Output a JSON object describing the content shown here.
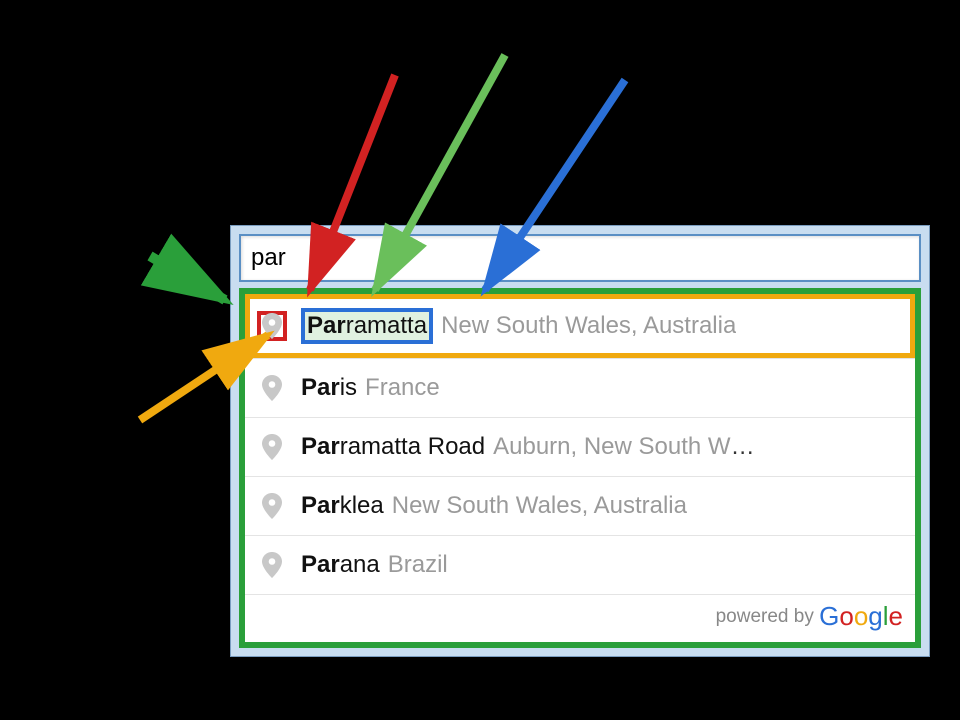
{
  "search": {
    "value": "par"
  },
  "suggestions": [
    {
      "matched": "Par",
      "rest": "ramatta",
      "secondary": "New South Wales, Australia",
      "highlighted": true
    },
    {
      "matched": "Par",
      "rest": "is",
      "secondary": "France",
      "highlighted": false
    },
    {
      "matched": "Par",
      "rest": "ramatta Road",
      "secondary": "Auburn, New South W",
      "truncated": true,
      "highlighted": false
    },
    {
      "matched": "Par",
      "rest": "klea",
      "secondary": "New South Wales, Australia",
      "highlighted": false
    },
    {
      "matched": "Par",
      "rest": "ana",
      "secondary": "Brazil",
      "highlighted": false
    }
  ],
  "footer": {
    "prefix": "powered by ",
    "brand": "Google"
  },
  "annotations": {
    "arrow_colors": {
      "red": "#d22222",
      "light_green": "#6abf5b",
      "blue": "#2a6fd6",
      "orange": "#f0a90f",
      "dark_green": "#2a9f3a"
    },
    "highlight_boxes": {
      "dropdown_container": "#2a9f3a",
      "first_row": "#f0a90f",
      "marker_icon": "#d22222",
      "main_text": "#2a6fd6"
    }
  }
}
